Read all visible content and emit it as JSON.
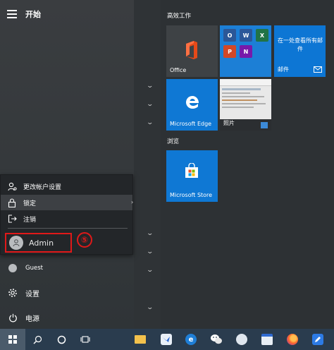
{
  "start_menu": {
    "title": "开始",
    "groups": [
      {
        "label": "高效工作"
      },
      {
        "label": "浏览"
      }
    ]
  },
  "user_popup": {
    "items": [
      {
        "label": "更改帐户设置",
        "icon": "account-settings-icon"
      },
      {
        "label": "锁定",
        "icon": "lock-icon"
      },
      {
        "label": "注销",
        "icon": "sign-out-icon"
      }
    ],
    "user": "Admin",
    "step": "⑤"
  },
  "nav": {
    "guest": "Guest",
    "settings": "设置",
    "power": "电源"
  },
  "tiles": {
    "office": "Office",
    "mail_text": "在一处查看所有邮件",
    "mail": "邮件",
    "edge": "Microsoft Edge",
    "photos": "照片",
    "store": "Microsoft Store"
  },
  "colors": {
    "accent_blue": "#0f78d4",
    "highlight_red": "#e01919",
    "taskbar": "#2a3c4e"
  }
}
